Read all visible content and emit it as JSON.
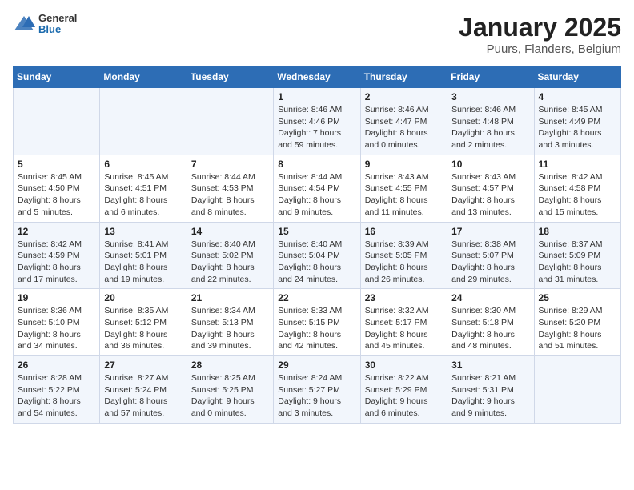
{
  "header": {
    "logo_general": "General",
    "logo_blue": "Blue",
    "title": "January 2025",
    "subtitle": "Puurs, Flanders, Belgium"
  },
  "weekdays": [
    "Sunday",
    "Monday",
    "Tuesday",
    "Wednesday",
    "Thursday",
    "Friday",
    "Saturday"
  ],
  "weeks": [
    [
      {
        "day": "",
        "info": ""
      },
      {
        "day": "",
        "info": ""
      },
      {
        "day": "",
        "info": ""
      },
      {
        "day": "1",
        "info": "Sunrise: 8:46 AM\nSunset: 4:46 PM\nDaylight: 7 hours and 59 minutes."
      },
      {
        "day": "2",
        "info": "Sunrise: 8:46 AM\nSunset: 4:47 PM\nDaylight: 8 hours and 0 minutes."
      },
      {
        "day": "3",
        "info": "Sunrise: 8:46 AM\nSunset: 4:48 PM\nDaylight: 8 hours and 2 minutes."
      },
      {
        "day": "4",
        "info": "Sunrise: 8:45 AM\nSunset: 4:49 PM\nDaylight: 8 hours and 3 minutes."
      }
    ],
    [
      {
        "day": "5",
        "info": "Sunrise: 8:45 AM\nSunset: 4:50 PM\nDaylight: 8 hours and 5 minutes."
      },
      {
        "day": "6",
        "info": "Sunrise: 8:45 AM\nSunset: 4:51 PM\nDaylight: 8 hours and 6 minutes."
      },
      {
        "day": "7",
        "info": "Sunrise: 8:44 AM\nSunset: 4:53 PM\nDaylight: 8 hours and 8 minutes."
      },
      {
        "day": "8",
        "info": "Sunrise: 8:44 AM\nSunset: 4:54 PM\nDaylight: 8 hours and 9 minutes."
      },
      {
        "day": "9",
        "info": "Sunrise: 8:43 AM\nSunset: 4:55 PM\nDaylight: 8 hours and 11 minutes."
      },
      {
        "day": "10",
        "info": "Sunrise: 8:43 AM\nSunset: 4:57 PM\nDaylight: 8 hours and 13 minutes."
      },
      {
        "day": "11",
        "info": "Sunrise: 8:42 AM\nSunset: 4:58 PM\nDaylight: 8 hours and 15 minutes."
      }
    ],
    [
      {
        "day": "12",
        "info": "Sunrise: 8:42 AM\nSunset: 4:59 PM\nDaylight: 8 hours and 17 minutes."
      },
      {
        "day": "13",
        "info": "Sunrise: 8:41 AM\nSunset: 5:01 PM\nDaylight: 8 hours and 19 minutes."
      },
      {
        "day": "14",
        "info": "Sunrise: 8:40 AM\nSunset: 5:02 PM\nDaylight: 8 hours and 22 minutes."
      },
      {
        "day": "15",
        "info": "Sunrise: 8:40 AM\nSunset: 5:04 PM\nDaylight: 8 hours and 24 minutes."
      },
      {
        "day": "16",
        "info": "Sunrise: 8:39 AM\nSunset: 5:05 PM\nDaylight: 8 hours and 26 minutes."
      },
      {
        "day": "17",
        "info": "Sunrise: 8:38 AM\nSunset: 5:07 PM\nDaylight: 8 hours and 29 minutes."
      },
      {
        "day": "18",
        "info": "Sunrise: 8:37 AM\nSunset: 5:09 PM\nDaylight: 8 hours and 31 minutes."
      }
    ],
    [
      {
        "day": "19",
        "info": "Sunrise: 8:36 AM\nSunset: 5:10 PM\nDaylight: 8 hours and 34 minutes."
      },
      {
        "day": "20",
        "info": "Sunrise: 8:35 AM\nSunset: 5:12 PM\nDaylight: 8 hours and 36 minutes."
      },
      {
        "day": "21",
        "info": "Sunrise: 8:34 AM\nSunset: 5:13 PM\nDaylight: 8 hours and 39 minutes."
      },
      {
        "day": "22",
        "info": "Sunrise: 8:33 AM\nSunset: 5:15 PM\nDaylight: 8 hours and 42 minutes."
      },
      {
        "day": "23",
        "info": "Sunrise: 8:32 AM\nSunset: 5:17 PM\nDaylight: 8 hours and 45 minutes."
      },
      {
        "day": "24",
        "info": "Sunrise: 8:30 AM\nSunset: 5:18 PM\nDaylight: 8 hours and 48 minutes."
      },
      {
        "day": "25",
        "info": "Sunrise: 8:29 AM\nSunset: 5:20 PM\nDaylight: 8 hours and 51 minutes."
      }
    ],
    [
      {
        "day": "26",
        "info": "Sunrise: 8:28 AM\nSunset: 5:22 PM\nDaylight: 8 hours and 54 minutes."
      },
      {
        "day": "27",
        "info": "Sunrise: 8:27 AM\nSunset: 5:24 PM\nDaylight: 8 hours and 57 minutes."
      },
      {
        "day": "28",
        "info": "Sunrise: 8:25 AM\nSunset: 5:25 PM\nDaylight: 9 hours and 0 minutes."
      },
      {
        "day": "29",
        "info": "Sunrise: 8:24 AM\nSunset: 5:27 PM\nDaylight: 9 hours and 3 minutes."
      },
      {
        "day": "30",
        "info": "Sunrise: 8:22 AM\nSunset: 5:29 PM\nDaylight: 9 hours and 6 minutes."
      },
      {
        "day": "31",
        "info": "Sunrise: 8:21 AM\nSunset: 5:31 PM\nDaylight: 9 hours and 9 minutes."
      },
      {
        "day": "",
        "info": ""
      }
    ]
  ]
}
